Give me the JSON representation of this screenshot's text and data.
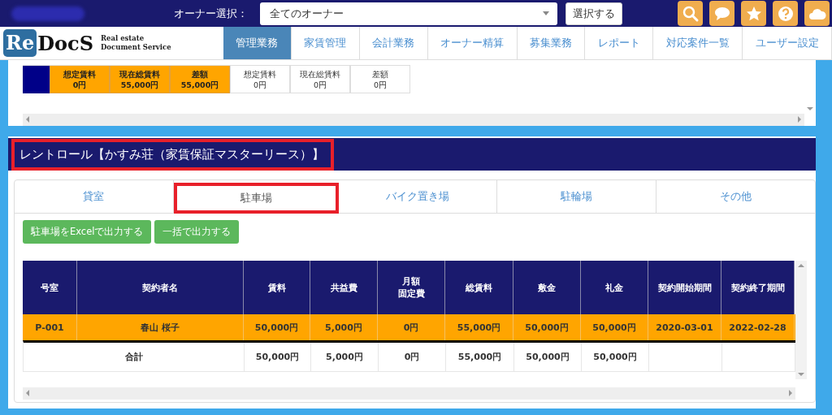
{
  "top_bar": {
    "owner_label": "オーナー選択：",
    "owner_select": {
      "value": "全てのオーナー"
    },
    "select_button": "選択する"
  },
  "logo": {
    "mark": "Re",
    "name": "DocS",
    "tagline_1": "Real estate",
    "tagline_2": "Document Service"
  },
  "nav": [
    {
      "label": "管理業務",
      "selected": true
    },
    {
      "label": "家賃管理",
      "selected": false
    },
    {
      "label": "会計業務",
      "selected": false
    },
    {
      "label": "オーナー精算",
      "selected": false
    },
    {
      "label": "募集業務",
      "selected": false
    },
    {
      "label": "レポート",
      "selected": false
    },
    {
      "label": "対応案件一覧",
      "selected": false
    },
    {
      "label": "ユーザー設定",
      "selected": false
    }
  ],
  "summary": [
    {
      "label": "想定賃料",
      "value": "0円",
      "highlighted": true
    },
    {
      "label": "現在総賃料",
      "value": "55,000円",
      "highlighted": true
    },
    {
      "label": "差額",
      "value": "55,000円",
      "highlighted": true
    },
    {
      "label": "想定賃料",
      "value": "0円",
      "highlighted": false
    },
    {
      "label": "現在総賃料",
      "value": "0円",
      "highlighted": false
    },
    {
      "label": "差額",
      "value": "0円",
      "highlighted": false
    }
  ],
  "section": {
    "title": "レントロール【かすみ荘（家賃保証マスターリース）】",
    "annotated": true
  },
  "tabs": [
    {
      "label": "貸室",
      "selected": false,
      "annotated": false
    },
    {
      "label": "駐車場",
      "selected": true,
      "annotated": true
    },
    {
      "label": "バイク置き場",
      "selected": false,
      "annotated": false
    },
    {
      "label": "駐輪場",
      "selected": false,
      "annotated": false
    },
    {
      "label": "その他",
      "selected": false,
      "annotated": false
    }
  ],
  "buttons": [
    "駐車場をExcelで出力する",
    "一括で出力する"
  ],
  "table": {
    "columns": [
      {
        "lines": [
          "号室"
        ]
      },
      {
        "lines": [
          "契約者名"
        ]
      },
      {
        "lines": [
          "賃料"
        ]
      },
      {
        "lines": [
          "共益費"
        ]
      },
      {
        "lines": [
          "月額",
          "固定費"
        ]
      },
      {
        "lines": [
          "総賃料"
        ]
      },
      {
        "lines": [
          "敷金"
        ]
      },
      {
        "lines": [
          "礼金"
        ]
      },
      {
        "lines": [
          "契約開始期間"
        ]
      },
      {
        "lines": [
          "契約終了期間"
        ]
      }
    ],
    "rows": [
      {
        "selected": true,
        "cells": [
          "P-001",
          "春山 桜子",
          "50,000円",
          "5,000円",
          "0円",
          "55,000円",
          "50,000円",
          "50,000円",
          "2020-03-01",
          "2022-02-28"
        ]
      }
    ],
    "total": {
      "label": "合計",
      "values": [
        "50,000円",
        "5,000円",
        "0円",
        "55,000円",
        "50,000円",
        "50,000円"
      ]
    }
  }
}
